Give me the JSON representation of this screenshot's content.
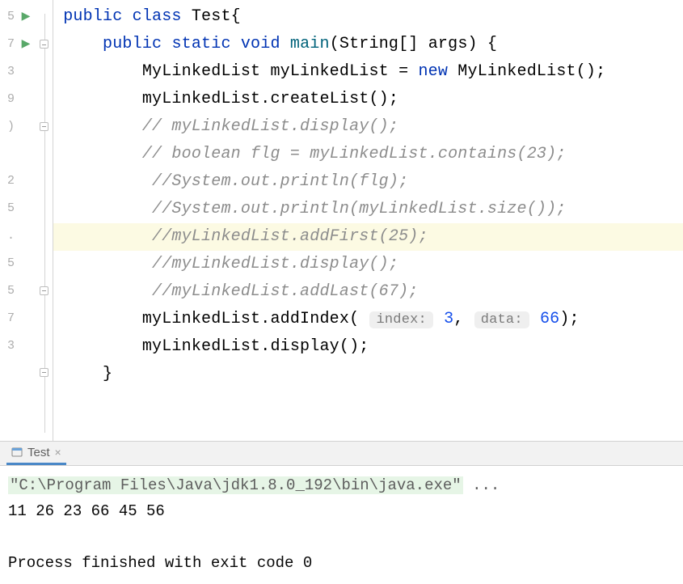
{
  "gutter_numbers": [
    "5",
    "7",
    "3",
    "9",
    ")",
    "",
    "2",
    "5",
    ".",
    "5",
    "5",
    "7",
    "3",
    "",
    "",
    ""
  ],
  "code": {
    "l0": {
      "kw1": "public",
      "kw2": "class",
      "cls": "Test",
      "rest": "{"
    },
    "l1": {
      "kw1": "public",
      "kw2": "static",
      "kw3": "void",
      "fn": "main",
      "sig": "(String[] args) {"
    },
    "l2": {
      "a": "MyLinkedList myLinkedList = ",
      "kw": "new",
      "b": " MyLinkedList();"
    },
    "l3": "myLinkedList.createList();",
    "l4": "// myLinkedList.display();",
    "l5": "// boolean flg = myLinkedList.contains(23);",
    "l6": " //System.out.println(flg);",
    "l7": " //System.out.println(myLinkedList.size());",
    "l8": " //myLinkedList.addFirst(25);",
    "l9": " //myLinkedList.display();",
    "l10": " //myLinkedList.addLast(67);",
    "l11": {
      "a": "myLinkedList.addIndex( ",
      "h1": "index:",
      "n1": "3",
      "mid": ", ",
      "h2": "data:",
      "n2": "66",
      "end": ");"
    },
    "l12": "myLinkedList.display();",
    "l13": "}"
  },
  "console": {
    "tab_label": "Test",
    "cmd": "\"C:\\Program Files\\Java\\jdk1.8.0_192\\bin\\java.exe\"",
    "ellipsis": "...",
    "output": "11 26 23 66 45 56",
    "exit": "Process finished with exit code 0"
  }
}
